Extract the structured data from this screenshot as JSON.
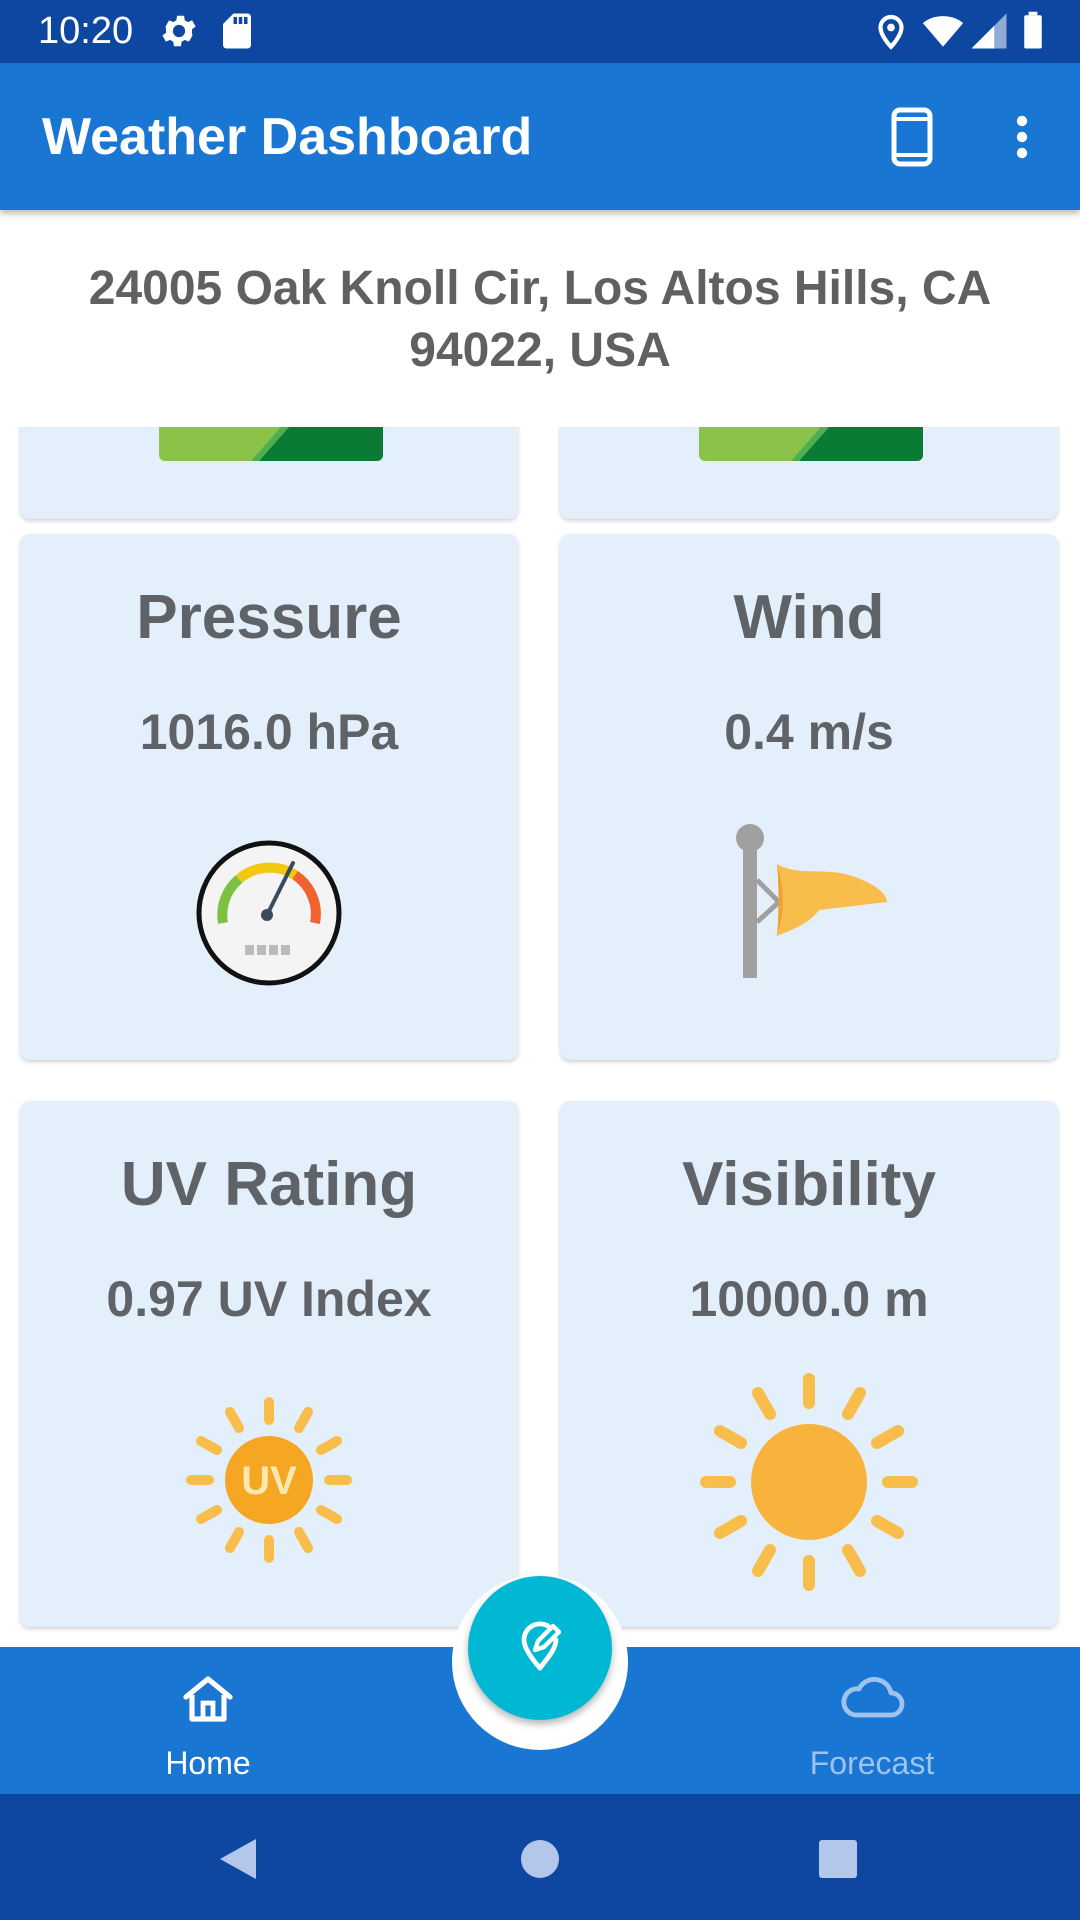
{
  "status_bar": {
    "time": "10:20",
    "icons": [
      "settings-icon",
      "sd-card-icon",
      "location-icon",
      "wifi-icon",
      "signal-icon",
      "battery-icon"
    ]
  },
  "app_bar": {
    "title": "Weather Dashboard",
    "actions": [
      "phone-icon",
      "more-vert-icon"
    ]
  },
  "address": "24005 Oak Knoll Cir, Los Altos Hills, CA 94022, USA",
  "cards": [
    {
      "title": "Pressure",
      "value": "1016.0 hPa",
      "icon": "pressure-gauge-icon"
    },
    {
      "title": "Wind",
      "value": "0.4 m/s",
      "icon": "windsock-icon"
    },
    {
      "title": "UV Rating",
      "value": "0.97 UV Index",
      "icon": "uv-sun-icon",
      "icon_text": "UV"
    },
    {
      "title": "Visibility",
      "value": "10000.0 m",
      "icon": "sun-icon"
    }
  ],
  "bottom_nav": {
    "items": [
      {
        "label": "Home",
        "icon": "home-icon",
        "active": true
      },
      {
        "label": "Forecast",
        "icon": "cloud-icon",
        "active": false
      }
    ],
    "fab_icon": "edit-location-icon"
  },
  "system_nav": [
    "back-icon",
    "home-circle-icon",
    "recents-icon"
  ],
  "colors": {
    "status_bar": "#0d47a1",
    "app_bar": "#1976d2",
    "card_bg": "#e3f0fb",
    "text_gray": "#5f6368",
    "fab": "#00b8d4",
    "nav_inactive": "#9ec3ee"
  }
}
